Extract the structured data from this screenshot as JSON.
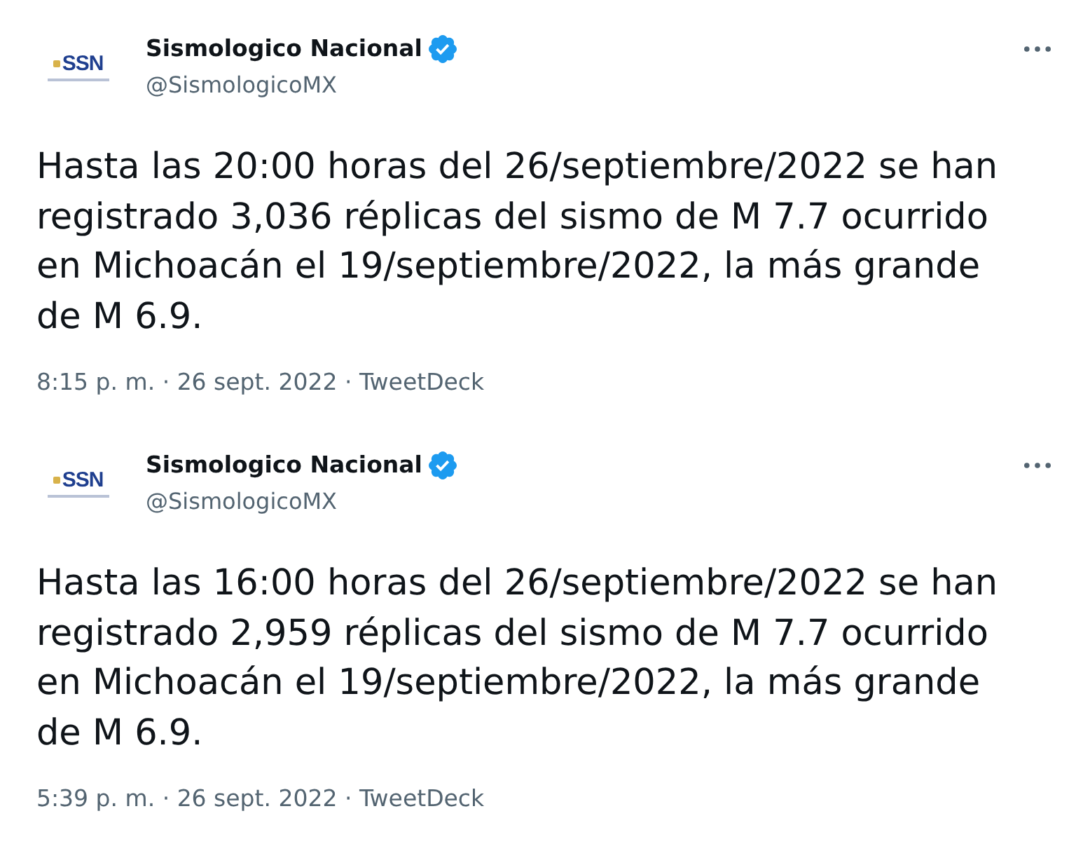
{
  "tweets": [
    {
      "author": {
        "name": "Sismologico Nacional",
        "handle": "@SismologicoMX",
        "verified": true,
        "logo_text": "SSN"
      },
      "text": "Hasta las 20:00 horas del 26/septiembre/2022 se han registrado 3,036 réplicas del sismo de M 7.7 ocurrido en Michoacán el 19/septiembre/2022, la más grande de M 6.9.",
      "meta": "8:15 p. m. · 26 sept. 2022 · TweetDeck"
    },
    {
      "author": {
        "name": "Sismologico Nacional",
        "handle": "@SismologicoMX",
        "verified": true,
        "logo_text": "SSN"
      },
      "text": "Hasta las 16:00 horas del 26/septiembre/2022 se han registrado 2,959 réplicas del sismo de M 7.7 ocurrido en Michoacán el 19/septiembre/2022, la más grande de M 6.9.",
      "meta": "5:39 p. m. · 26 sept. 2022 · TweetDeck"
    }
  ]
}
